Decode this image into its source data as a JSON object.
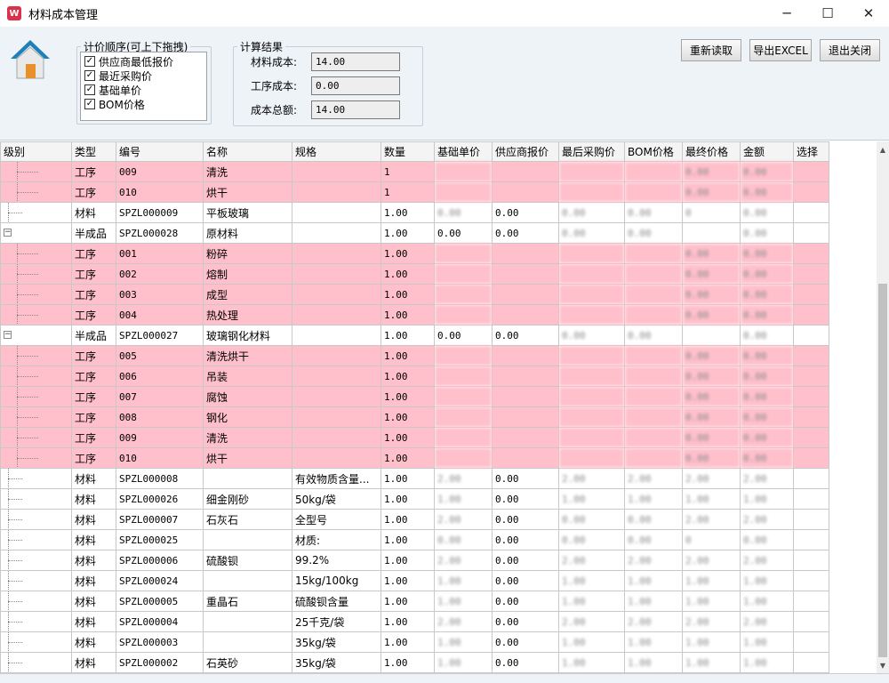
{
  "window": {
    "title": "材料成本管理",
    "app_icon_glyph": "W",
    "minimize_glyph": "─",
    "maximize_glyph": "☐",
    "close_glyph": "✕"
  },
  "order_group": {
    "legend": "计价顺序(可上下拖拽)",
    "items": [
      {
        "label": "供应商最低报价",
        "checked": true
      },
      {
        "label": "最近采购价",
        "checked": true
      },
      {
        "label": "基础单价",
        "checked": true
      },
      {
        "label": "BOM价格",
        "checked": true
      }
    ]
  },
  "result_group": {
    "legend": "计算结果",
    "material_cost_label": "材料成本:",
    "material_cost_value": "14.00",
    "process_cost_label": "工序成本:",
    "process_cost_value": "0.00",
    "total_cost_label": "成本总额:",
    "total_cost_value": "14.00"
  },
  "buttons": {
    "reload": "重新读取",
    "export": "导出EXCEL",
    "exit": "退出关闭"
  },
  "grid": {
    "columns": [
      "级别",
      "类型",
      "编号",
      "名称",
      "规格",
      "数量",
      "基础单价",
      "供应商报价",
      "最后采购价",
      "BOM价格",
      "最终价格",
      "金额",
      "选择"
    ],
    "rows": [
      {
        "level": 2,
        "pink": true,
        "type": "工序",
        "code": "009",
        "name": "清洗",
        "spec": "",
        "qty": "1",
        "base": "",
        "supplier": "",
        "last": "",
        "bom": "",
        "final": "0.00",
        "amount": "0.00"
      },
      {
        "level": 2,
        "pink": true,
        "type": "工序",
        "code": "010",
        "name": "烘干",
        "spec": "",
        "qty": "1",
        "base": "",
        "supplier": "",
        "last": "",
        "bom": "",
        "final": "0.00",
        "amount": "0.00"
      },
      {
        "level": 1,
        "pink": false,
        "type": "材料",
        "code": "SPZL000009",
        "name": "平板玻璃",
        "spec": "",
        "qty": "1.00",
        "base": "0.00",
        "supplier": "0.00",
        "last": "0.00",
        "bom": "0.00",
        "final": "0",
        "amount": "0.00"
      },
      {
        "level": 0,
        "pink": false,
        "toggle": true,
        "type": "半成品",
        "code": "SPZL000028",
        "name": "原材料",
        "spec": "",
        "qty": "1.00",
        "base": "0.00",
        "supplier": "0.00",
        "last": "0.00",
        "bom": "0.00",
        "final": "",
        "amount": "0.00"
      },
      {
        "level": 2,
        "pink": true,
        "type": "工序",
        "code": "001",
        "name": "粉碎",
        "spec": "",
        "qty": "1.00",
        "base": "",
        "supplier": "",
        "last": "",
        "bom": "",
        "final": "0.00",
        "amount": "0.00"
      },
      {
        "level": 2,
        "pink": true,
        "type": "工序",
        "code": "002",
        "name": "熔制",
        "spec": "",
        "qty": "1.00",
        "base": "",
        "supplier": "",
        "last": "",
        "bom": "",
        "final": "0.00",
        "amount": "0.00"
      },
      {
        "level": 2,
        "pink": true,
        "type": "工序",
        "code": "003",
        "name": "成型",
        "spec": "",
        "qty": "1.00",
        "base": "",
        "supplier": "",
        "last": "",
        "bom": "",
        "final": "0.00",
        "amount": "0.00"
      },
      {
        "level": 2,
        "pink": true,
        "type": "工序",
        "code": "004",
        "name": "热处理",
        "spec": "",
        "qty": "1.00",
        "base": "",
        "supplier": "",
        "last": "",
        "bom": "",
        "final": "0.00",
        "amount": "0.00"
      },
      {
        "level": 0,
        "pink": false,
        "toggle": true,
        "type": "半成品",
        "code": "SPZL000027",
        "name": "玻璃钢化材料",
        "spec": "",
        "qty": "1.00",
        "base": "0.00",
        "supplier": "0.00",
        "last": "0.00",
        "bom": "0.00",
        "final": "",
        "amount": "0.00"
      },
      {
        "level": 2,
        "pink": true,
        "type": "工序",
        "code": "005",
        "name": "清洗烘干",
        "spec": "",
        "qty": "1.00",
        "base": "",
        "supplier": "",
        "last": "",
        "bom": "",
        "final": "0.00",
        "amount": "0.00"
      },
      {
        "level": 2,
        "pink": true,
        "type": "工序",
        "code": "006",
        "name": "吊装",
        "spec": "",
        "qty": "1.00",
        "base": "",
        "supplier": "",
        "last": "",
        "bom": "",
        "final": "0.00",
        "amount": "0.00"
      },
      {
        "level": 2,
        "pink": true,
        "type": "工序",
        "code": "007",
        "name": "腐蚀",
        "spec": "",
        "qty": "1.00",
        "base": "",
        "supplier": "",
        "last": "",
        "bom": "",
        "final": "0.00",
        "amount": "0.00"
      },
      {
        "level": 2,
        "pink": true,
        "type": "工序",
        "code": "008",
        "name": "钢化",
        "spec": "",
        "qty": "1.00",
        "base": "",
        "supplier": "",
        "last": "",
        "bom": "",
        "final": "0.00",
        "amount": "0.00"
      },
      {
        "level": 2,
        "pink": true,
        "type": "工序",
        "code": "009",
        "name": "清洗",
        "spec": "",
        "qty": "1.00",
        "base": "",
        "supplier": "",
        "last": "",
        "bom": "",
        "final": "0.00",
        "amount": "0.00"
      },
      {
        "level": 2,
        "pink": true,
        "type": "工序",
        "code": "010",
        "name": "烘干",
        "spec": "",
        "qty": "1.00",
        "base": "",
        "supplier": "",
        "last": "",
        "bom": "",
        "final": "0.00",
        "amount": "0.00"
      },
      {
        "level": 1,
        "pink": false,
        "type": "材料",
        "code": "SPZL000008",
        "name": "",
        "spec": "有效物质含量...",
        "qty": "1.00",
        "base": "2.00",
        "supplier": "0.00",
        "last": "2.00",
        "bom": "2.00",
        "final": "2.00",
        "amount": "2.00"
      },
      {
        "level": 1,
        "pink": false,
        "type": "材料",
        "code": "SPZL000026",
        "name": "细金刚砂",
        "spec": "50kg/袋",
        "qty": "1.00",
        "base": "1.00",
        "supplier": "0.00",
        "last": "1.00",
        "bom": "1.00",
        "final": "1.00",
        "amount": "1.00"
      },
      {
        "level": 1,
        "pink": false,
        "type": "材料",
        "code": "SPZL000007",
        "name": "石灰石",
        "spec": "全型号",
        "qty": "1.00",
        "base": "2.00",
        "supplier": "0.00",
        "last": "0.00",
        "bom": "0.00",
        "final": "2.00",
        "amount": "2.00"
      },
      {
        "level": 1,
        "pink": false,
        "type": "材料",
        "code": "SPZL000025",
        "name": "",
        "spec": "材质:",
        "qty": "1.00",
        "base": "0.00",
        "supplier": "0.00",
        "last": "0.00",
        "bom": "0.00",
        "final": "0",
        "amount": "0.00"
      },
      {
        "level": 1,
        "pink": false,
        "type": "材料",
        "code": "SPZL000006",
        "name": "硫酸钡",
        "spec": "99.2%",
        "qty": "1.00",
        "base": "2.00",
        "supplier": "0.00",
        "last": "2.00",
        "bom": "2.00",
        "final": "2.00",
        "amount": "2.00"
      },
      {
        "level": 1,
        "pink": false,
        "type": "材料",
        "code": "SPZL000024",
        "name": "",
        "spec": "15kg/100kg",
        "qty": "1.00",
        "base": "1.00",
        "supplier": "0.00",
        "last": "1.00",
        "bom": "1.00",
        "final": "1.00",
        "amount": "1.00"
      },
      {
        "level": 1,
        "pink": false,
        "type": "材料",
        "code": "SPZL000005",
        "name": "重晶石",
        "spec": "硫酸钡含量",
        "qty": "1.00",
        "base": "1.00",
        "supplier": "0.00",
        "last": "1.00",
        "bom": "1.00",
        "final": "1.00",
        "amount": "1.00"
      },
      {
        "level": 1,
        "pink": false,
        "type": "材料",
        "code": "SPZL000004",
        "name": "",
        "spec": "25千克/袋",
        "qty": "1.00",
        "base": "2.00",
        "supplier": "0.00",
        "last": "2.00",
        "bom": "2.00",
        "final": "2.00",
        "amount": "2.00"
      },
      {
        "level": 1,
        "pink": false,
        "type": "材料",
        "code": "SPZL000003",
        "name": "",
        "spec": "35kg/袋",
        "qty": "1.00",
        "base": "1.00",
        "supplier": "0.00",
        "last": "1.00",
        "bom": "1.00",
        "final": "1.00",
        "amount": "1.00"
      },
      {
        "level": 1,
        "pink": false,
        "type": "材料",
        "code": "SPZL000002",
        "name": "石英砂",
        "spec": "35kg/袋",
        "qty": "1.00",
        "base": "1.00",
        "supplier": "0.00",
        "last": "1.00",
        "bom": "1.00",
        "final": "1.00",
        "amount": "1.00"
      }
    ]
  },
  "colors": {
    "process_row_bg": "#ffc0cb",
    "panel_bg": "#eef3f8",
    "app_icon": "#d8334a"
  },
  "icons": {
    "app": "app-logo-icon",
    "home": "home-icon",
    "scroll_up": "▲",
    "scroll_down": "▼",
    "check": "✓",
    "collapse": "−"
  }
}
